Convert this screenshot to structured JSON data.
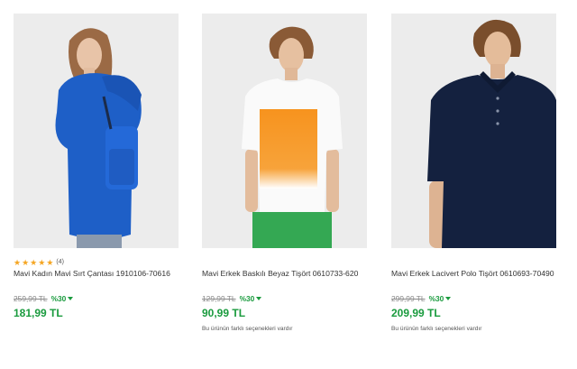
{
  "products": [
    {
      "title": "Mavi Kadın Mavi Sırt Çantası 1910106-70616",
      "rating_stars": 5,
      "review_count": "(4)",
      "old_price": "259,99 TL",
      "discount": "%30",
      "price": "181,99 TL",
      "variants_note": ""
    },
    {
      "title": "Mavi Erkek Baskılı Beyaz Tişört 0610733-620",
      "old_price": "129,99 TL",
      "discount": "%30",
      "price": "90,99 TL",
      "variants_note": "Bu ürünün farklı seçenekleri vardır"
    },
    {
      "title": "Mavi Erkek Lacivert Polo Tişört 0610693-70490",
      "old_price": "299,99 TL",
      "discount": "%30",
      "price": "209,99 TL",
      "variants_note": "Bu ürünün farklı seçenekleri vardır"
    }
  ],
  "colors": {
    "sale_green": "#1a9b3e",
    "star": "#f5a623",
    "old_price": "#8a8a8a",
    "photo_bg": "#ebebeb"
  },
  "icons": [
    "star-icon",
    "discount-down-arrow-icon"
  ]
}
